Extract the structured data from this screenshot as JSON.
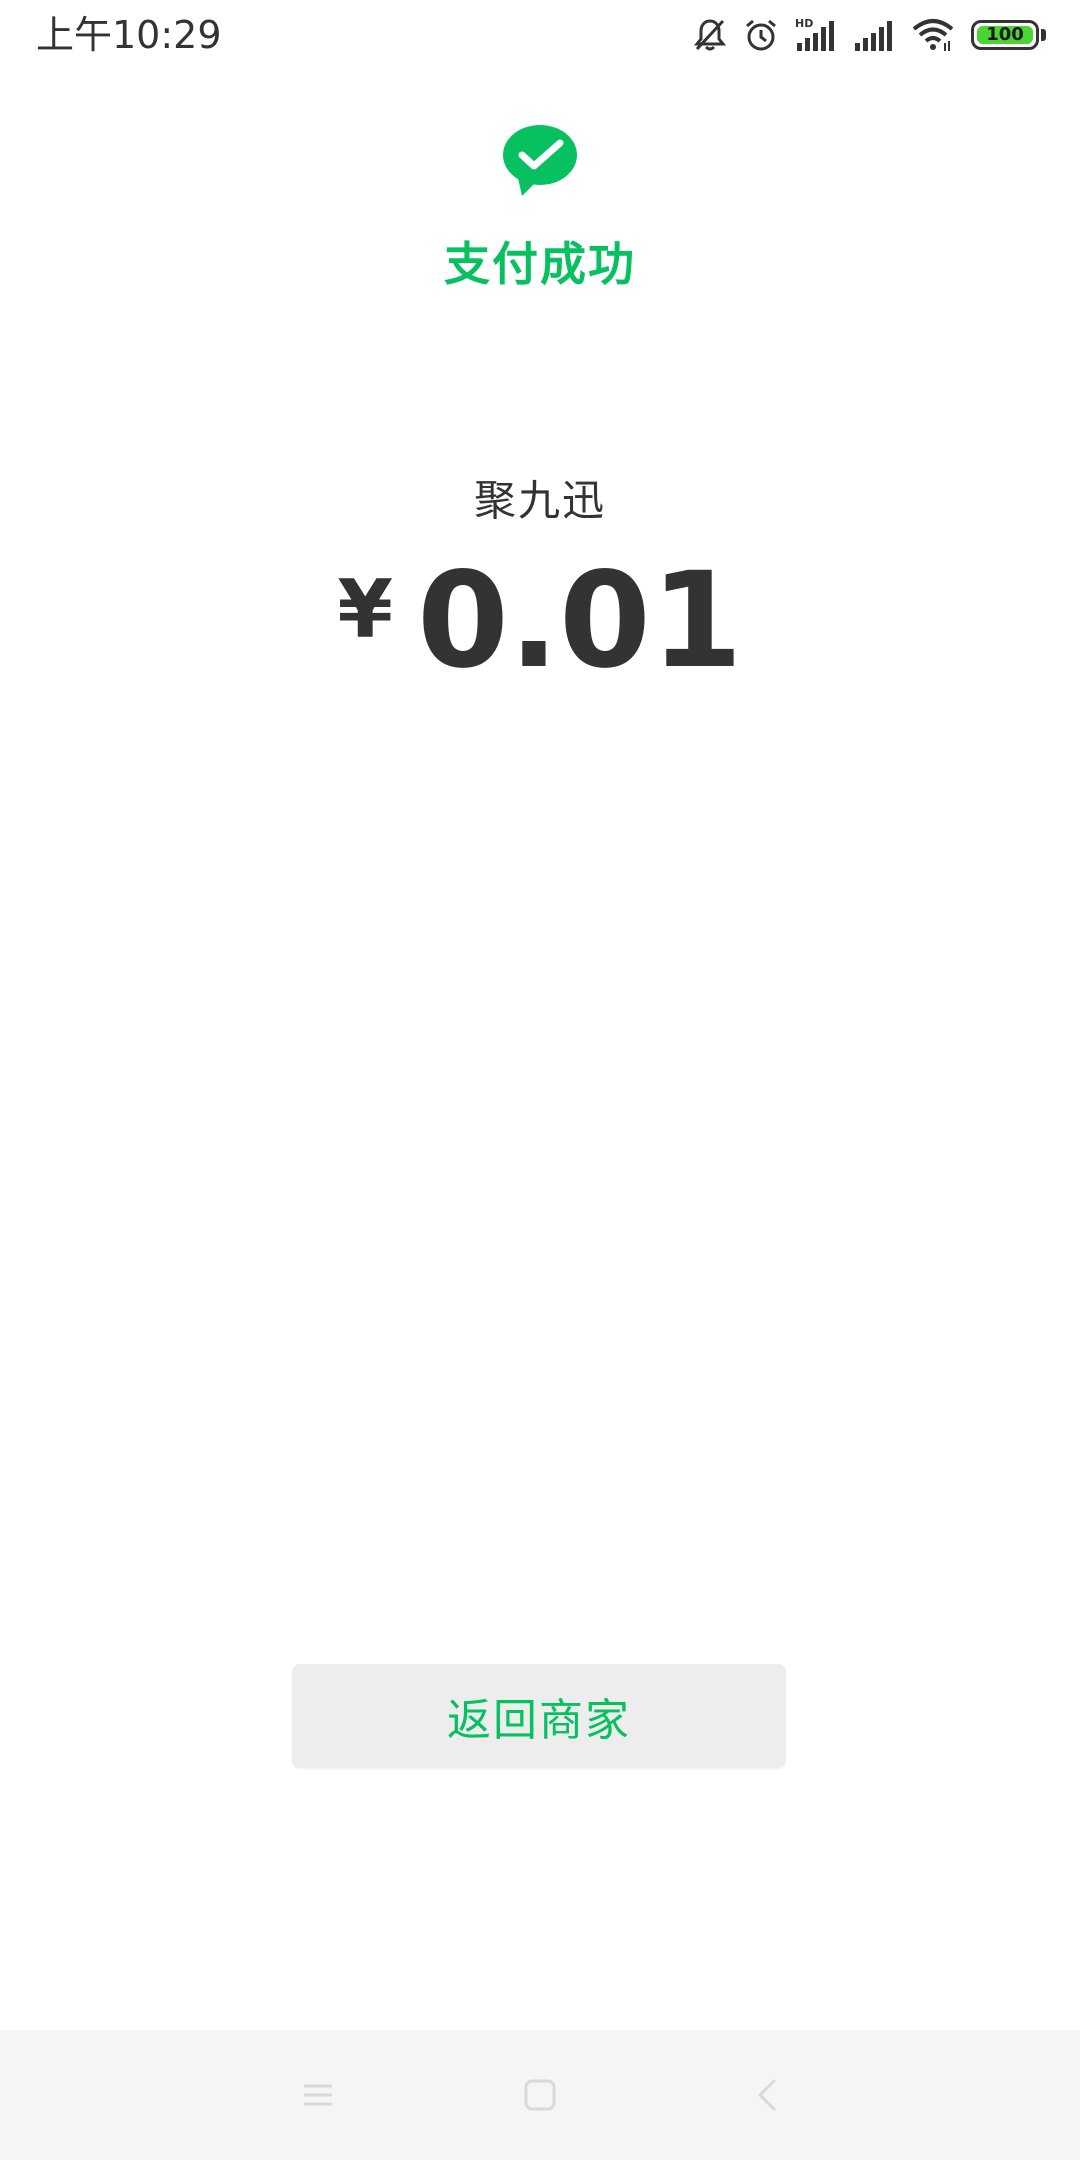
{
  "status_bar": {
    "time": "上午10:29",
    "battery_level": "100",
    "battery_color": "#4cd334",
    "network_label": "HD",
    "icons": [
      "bell-muted-icon",
      "alarm-icon",
      "hd-signal-icon",
      "signal-icon",
      "wifi-icon",
      "battery-icon"
    ]
  },
  "payment": {
    "brand_color": "#07c160",
    "logo_icon": "wechat-pay-icon",
    "status_title": "支付成功",
    "merchant_name": "聚九迅",
    "currency_symbol": "¥",
    "amount": "0.01"
  },
  "actions": {
    "return_button_label": "返回商家"
  },
  "nav_bar": {
    "icons": [
      "menu-icon",
      "home-icon",
      "back-icon"
    ]
  }
}
